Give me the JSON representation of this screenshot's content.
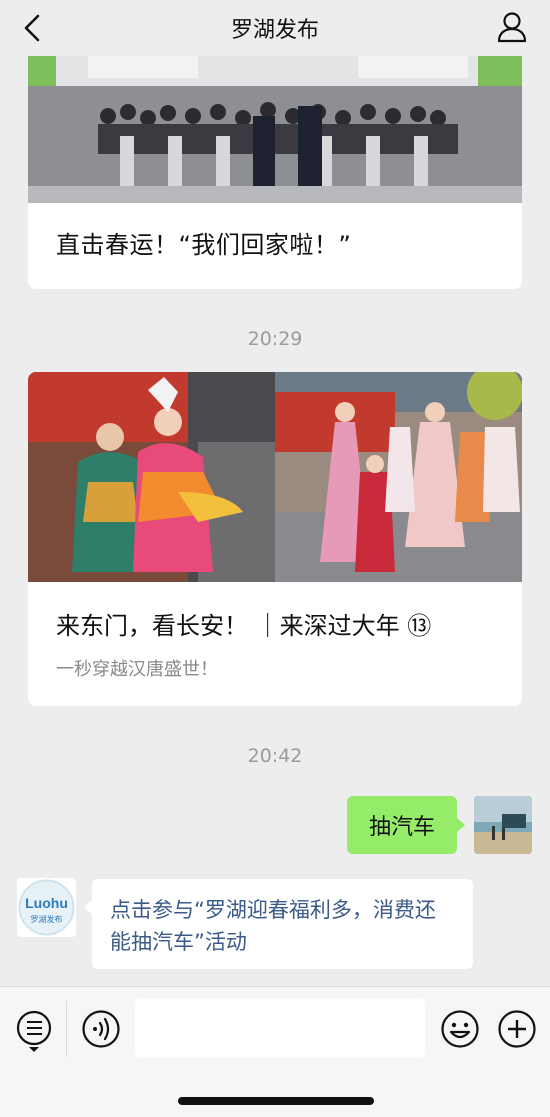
{
  "header": {
    "title": "罗湖发布"
  },
  "messages": {
    "card1": {
      "caption": "直击春运！“我们回家啦！”"
    },
    "time1": "20:29",
    "card2": {
      "title": "来东门，看长安！ ｜来深过大年 ⑬",
      "subtitle": "一秒穿越汉唐盛世！"
    },
    "time2": "20:42",
    "outgoing": {
      "text": "抽汽车"
    },
    "incoming": {
      "avatar_text": "Luohu",
      "avatar_subtext": "罗湖发布",
      "text": "点击参与“罗湖迎春福利多，消费还能抽汽车”活动"
    }
  },
  "input_bar": {
    "placeholder": ""
  },
  "colors": {
    "background": "#ededed",
    "outgoing_bubble": "#95ec69",
    "link_text": "#3b5a8a",
    "brand_blue": "#2a7bc0"
  },
  "icons": {
    "back": "back-chevron-icon",
    "profile": "person-icon",
    "menu": "list-menu-icon",
    "voice": "voice-icon",
    "emoji": "emoji-icon",
    "plus": "plus-icon"
  }
}
